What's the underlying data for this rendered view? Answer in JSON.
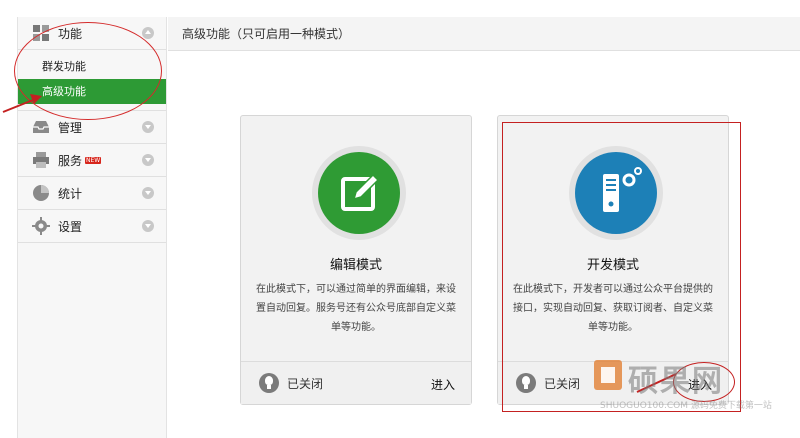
{
  "sidebar": {
    "groups": [
      {
        "label": "功能",
        "icon": "grid-icon"
      },
      {
        "label": "管理",
        "icon": "inbox-icon"
      },
      {
        "label": "服务",
        "icon": "printer-icon",
        "badge": "NEW"
      },
      {
        "label": "统计",
        "icon": "pie-chart-icon"
      },
      {
        "label": "设置",
        "icon": "gear-icon"
      }
    ],
    "sub_items": [
      "群发功能",
      "高级功能"
    ]
  },
  "main": {
    "header": "高级功能（只可启用一种模式）",
    "cards": [
      {
        "title": "编辑模式",
        "desc": "在此模式下，可以通过简单的界面编辑，来设置自动回复。服务号还有公众号底部自定义菜单等功能。",
        "status": "已关闭",
        "enter": "进入",
        "icon": "edit-icon"
      },
      {
        "title": "开发模式",
        "desc": "在此模式下，开发者可以通过公众平台提供的接口，实现自动回复、获取订阅者、自定义菜单等功能。",
        "status": "已关闭",
        "enter": "进入",
        "icon": "server-icon"
      }
    ]
  },
  "watermark": {
    "text": "硕果网",
    "sub": "SHUOGUO100.COM 源码免费下载第一站"
  },
  "colors": {
    "accent_green": "#2d9a35",
    "dev_blue": "#1d80b7",
    "annotation_red": "#d42b2b"
  }
}
